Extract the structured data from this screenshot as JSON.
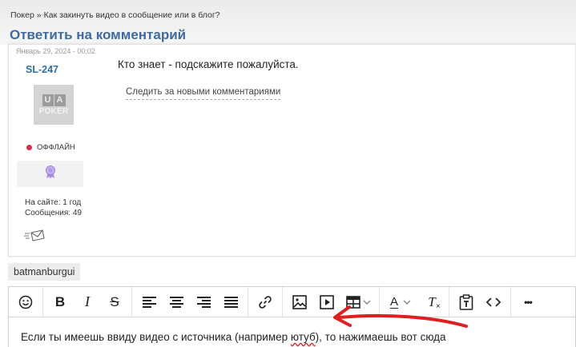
{
  "breadcrumb": {
    "items": [
      "Покер",
      "Как закинуть видео в сообщение или в блог?"
    ],
    "separator": "»"
  },
  "page_title": "Ответить на комментарий",
  "comment": {
    "date": "Январь 29, 2024 - 00:02",
    "author": "SL-247",
    "avatar_logo_top": [
      "U",
      "A"
    ],
    "avatar_logo_bottom": "POKER",
    "status": "ОФФЛАЙН",
    "on_site": "На сайте: 1 год",
    "posts": "Сообщения: 49",
    "text": "Кто знает - подскажите пожалуйста.",
    "follow_link": "Следить за новыми комментариями"
  },
  "reply": {
    "username": "batmanburgui",
    "editor_text_before": "Если ты имеешь ввиду видео с источника (например ",
    "editor_text_misspelled": "ютуб",
    "editor_text_after": "), то нажимаешь вот сюда"
  },
  "toolbar": {
    "bold": "B",
    "italic": "I",
    "strike": "S",
    "font_color": "A",
    "clear_format": "T",
    "more": "•••"
  },
  "colors": {
    "title": "#3f6b9e",
    "author": "#2d6fa8",
    "status_offline": "#e0284f",
    "annotation_arrow": "#e02020"
  },
  "icons": [
    "emoji-icon",
    "align-left-icon",
    "align-center-icon",
    "align-right-icon",
    "align-justify-icon",
    "link-icon",
    "image-icon",
    "video-icon",
    "table-icon",
    "paste-text-icon",
    "source-code-icon",
    "badge-icon",
    "private-message-icon"
  ]
}
